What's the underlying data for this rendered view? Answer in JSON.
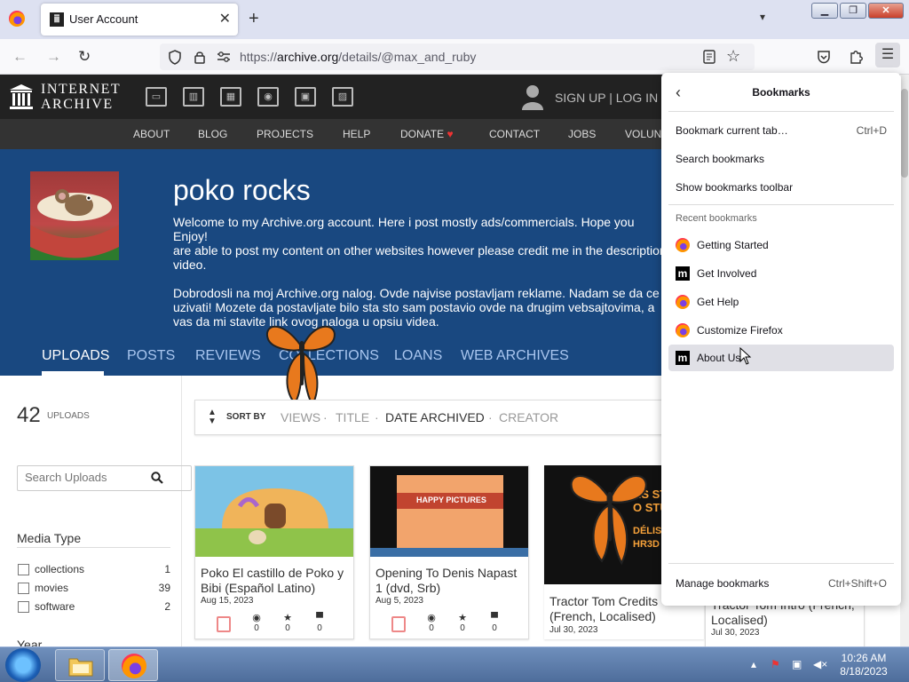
{
  "browser": {
    "tab_title": "User Account",
    "url_prefix": "https://",
    "url_domain": "archive.org",
    "url_path": "/details/@max_and_ruby"
  },
  "archive": {
    "logo_line1": "INTERNET",
    "logo_line2": "ARCHIVE",
    "signup_text": "SIGN UP | LOG IN",
    "subnav": [
      "ABOUT",
      "BLOG",
      "PROJECTS",
      "HELP",
      "DONATE",
      "CONTACT",
      "JOBS",
      "VOLUN"
    ],
    "profile_name": "poko rocks",
    "bio_lines_1": "Welcome to my Archive.org account. Here i post mostly ads/commercials. Hope you Enjoy!\nare able to post my content on other websites however please credit me in the description\nvideo.",
    "bio_lines_2": "Dobrodosli na moj Archive.org nalog. Ovde najvise postavljam reklame. Nadam se da ce\nuzivati! Mozete da postavljate bilo sta sto sam postavio ovde na drugim vebsajtovima, a\nvas da mi stavite link ovog naloga u opsiu videa.",
    "tabs": [
      "UPLOADS",
      "POSTS",
      "REVIEWS",
      "COLLECTIONS",
      "LOANS",
      "WEB ARCHIVES"
    ],
    "upload_count": "42",
    "upload_count_label": "UPLOADS",
    "search_placeholder": "Search Uploads",
    "facet_title": "Media Type",
    "facets": [
      {
        "label": "collections",
        "count": "1"
      },
      {
        "label": "movies",
        "count": "39"
      },
      {
        "label": "software",
        "count": "2"
      }
    ],
    "year_label": "Year",
    "sort_by": "SORT BY",
    "sort_options": [
      "VIEWS",
      "TITLE",
      "DATE ARCHIVED",
      "CREATOR"
    ],
    "cards": [
      {
        "title": "Poko El castillo de Poko y Bibi (Español Latino)",
        "date": "Aug 15, 2023",
        "views": "0",
        "favs": "0",
        "reviews": "0"
      },
      {
        "title": "Opening To Denis Napast 1 (dvd, Srb)",
        "date": "Aug 5, 2023",
        "views": "0",
        "favs": "0",
        "reviews": "0",
        "thumb_text": "HAPPY PICTURES"
      },
      {
        "title": "Tractor Tom Credits (French, Localised)",
        "date": "Jul 30, 2023",
        "thumb_text1": "NS STUDIO",
        "thumb_text2": "O STUDIO",
        "thumb_text3": "DÉLISATION",
        "thumb_text4": "HR3D"
      },
      {
        "title": "Tractor Tom Intro (French, Localised)",
        "date": "Jul 30, 2023"
      }
    ]
  },
  "bookmarks_panel": {
    "title": "Bookmarks",
    "bookmark_tab": "Bookmark current tab…",
    "bookmark_tab_shortcut": "Ctrl+D",
    "search": "Search bookmarks",
    "show_toolbar": "Show bookmarks toolbar",
    "recent_label": "Recent bookmarks",
    "recent": [
      {
        "label": "Getting Started",
        "icon": "firefox-icon"
      },
      {
        "label": "Get Involved",
        "icon": "mozilla-icon"
      },
      {
        "label": "Get Help",
        "icon": "firefox-icon"
      },
      {
        "label": "Customize Firefox",
        "icon": "firefox-icon"
      },
      {
        "label": "About Us",
        "icon": "mozilla-icon"
      }
    ],
    "manage": "Manage bookmarks",
    "manage_shortcut": "Ctrl+Shift+O"
  },
  "taskbar": {
    "time": "10:26 AM",
    "date": "8/18/2023"
  }
}
